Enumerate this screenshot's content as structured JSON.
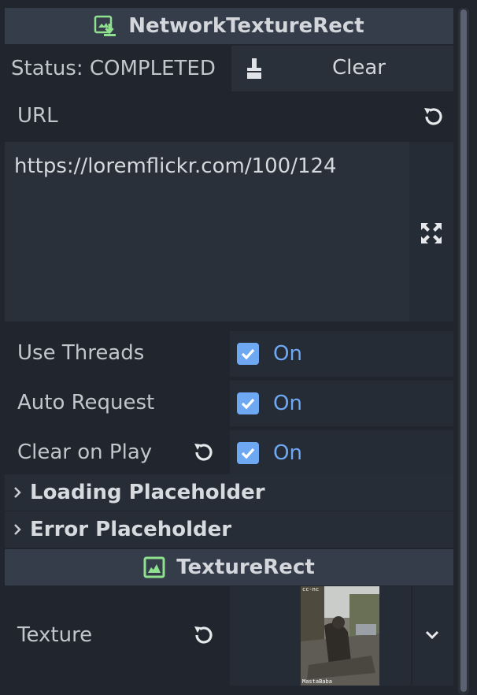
{
  "inspector": {
    "network_header": {
      "title": "NetworkTextureRect",
      "icon": "download-image-icon"
    },
    "status": {
      "label": "Status: COMPLETED"
    },
    "clear_button": {
      "label": "Clear",
      "icon": "broom-icon"
    },
    "url": {
      "label": "URL",
      "value": "https://loremflickr.com/100/124",
      "reset_icon": "revert-icon",
      "expand_icon": "expand-icon"
    },
    "properties": [
      {
        "label": "Use Threads",
        "value": "On",
        "checked": true
      },
      {
        "label": "Auto Request",
        "value": "On",
        "checked": true
      },
      {
        "label": "Clear on Play",
        "value": "On",
        "checked": true
      }
    ],
    "sections": [
      {
        "label": "Loading Placeholder"
      },
      {
        "label": "Error Placeholder"
      }
    ],
    "texture_header": {
      "title": "TextureRect",
      "icon": "texture-rect-icon"
    },
    "texture": {
      "label": "Texture",
      "preview_top_text": "cc-nc",
      "preview_bottom_text": "MastaBaba",
      "dropdown_icon": "chevron-down-icon"
    },
    "colors": {
      "accent": "#6fa8f2",
      "header_bg": "#363d4a",
      "icon_green": "#8fe08f"
    }
  }
}
